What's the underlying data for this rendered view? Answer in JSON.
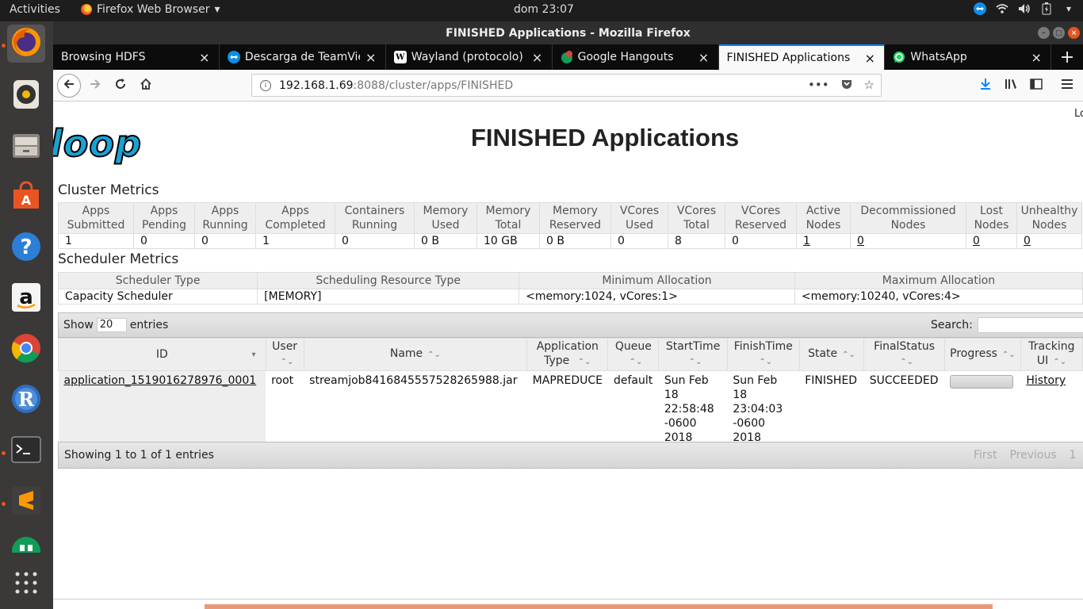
{
  "topbar": {
    "activities": "Activities",
    "app_name": "Firefox Web Browser",
    "app_menu_arrow": "▾",
    "clock": "dom 23:07"
  },
  "window": {
    "title": "FINISHED Applications - Mozilla Firefox"
  },
  "tabs": [
    {
      "title": "Browsing HDFS",
      "icon": "none-icon",
      "active": false
    },
    {
      "title": "Descarga de TeamViewer",
      "icon": "teamviewer-icon",
      "active": false
    },
    {
      "title": "Wayland (protocolo) -",
      "icon": "wikipedia-icon",
      "active": false
    },
    {
      "title": "Google Hangouts",
      "icon": "hangouts-icon",
      "active": false
    },
    {
      "title": "FINISHED Applications",
      "icon": "none-icon",
      "active": true
    },
    {
      "title": "WhatsApp",
      "icon": "whatsapp-icon",
      "active": false
    }
  ],
  "url": {
    "host": "192.168.1.69",
    "path": ":8088/cluster/apps/FINISHED"
  },
  "page": {
    "logo_text": "loop",
    "login_partial": "Lo",
    "title": "FINISHED Applications",
    "cluster_metrics_heading": "Cluster Metrics",
    "scheduler_metrics_heading": "Scheduler Metrics"
  },
  "cluster_metrics": {
    "headers": [
      [
        "Apps",
        "Submitted"
      ],
      [
        "Apps",
        "Pending"
      ],
      [
        "Apps",
        "Running"
      ],
      [
        "Apps",
        "Completed"
      ],
      [
        "Containers",
        "Running"
      ],
      [
        "Memory",
        "Used"
      ],
      [
        "Memory",
        "Total"
      ],
      [
        "Memory",
        "Reserved"
      ],
      [
        "VCores",
        "Used"
      ],
      [
        "VCores",
        "Total"
      ],
      [
        "VCores",
        "Reserved"
      ],
      [
        "Active",
        "Nodes"
      ],
      [
        "Decommissioned",
        "Nodes"
      ],
      [
        "Lost",
        "Nodes"
      ],
      [
        "Unhealthy",
        "Nodes"
      ]
    ],
    "values": [
      "1",
      "0",
      "0",
      "1",
      "0",
      "0 B",
      "10 GB",
      "0 B",
      "0",
      "8",
      "0",
      "1",
      "0",
      "0",
      "0"
    ]
  },
  "scheduler_metrics": {
    "headers": [
      "Scheduler Type",
      "Scheduling Resource Type",
      "Minimum Allocation",
      "Maximum Allocation"
    ],
    "values": [
      "Capacity Scheduler",
      "[MEMORY]",
      "<memory:1024, vCores:1>",
      "<memory:10240, vCores:4>"
    ]
  },
  "datatable": {
    "show_label": "Show",
    "show_value": "20",
    "entries_label": "entries",
    "search_label": "Search:",
    "info": "Showing 1 to 1 of 1 entries",
    "pager": {
      "first": "First",
      "previous": "Previous",
      "page": "1"
    }
  },
  "apps_table": {
    "headers": [
      {
        "label": "ID",
        "sort": "▾"
      },
      {
        "label": "User",
        "sort": "⌃⌄"
      },
      {
        "label": "Name",
        "sort": "⌃⌄"
      },
      {
        "label": "Application Type",
        "sort": "⌃⌄"
      },
      {
        "label": "Queue",
        "sort": "⌃⌄"
      },
      {
        "label": "StartTime",
        "sort": "⌃⌄"
      },
      {
        "label": "FinishTime",
        "sort": "⌃⌄"
      },
      {
        "label": "State",
        "sort": "⌃⌄"
      },
      {
        "label": "FinalStatus",
        "sort": "⌃⌄"
      },
      {
        "label": "Progress",
        "sort": "⌃⌄"
      },
      {
        "label": "Tracking UI",
        "sort": "⌃⌄"
      }
    ],
    "rows": [
      {
        "id": "application_1519016278976_0001",
        "user": "root",
        "name": "streamjob8416845557528265988.jar",
        "type": "MAPREDUCE",
        "queue": "default",
        "start": "Sun Feb 18 22:58:48 -0600 2018",
        "finish": "Sun Feb 18 23:04:03 -0600 2018",
        "state": "FINISHED",
        "final_status": "SUCCEEDED",
        "progress": 1.0,
        "tracking": "History"
      }
    ]
  },
  "colors": {
    "tab_active_accent": "#0a84ff",
    "ubuntu_orange": "#e95420",
    "hadoop_logo_blue": "#19a3d4"
  }
}
